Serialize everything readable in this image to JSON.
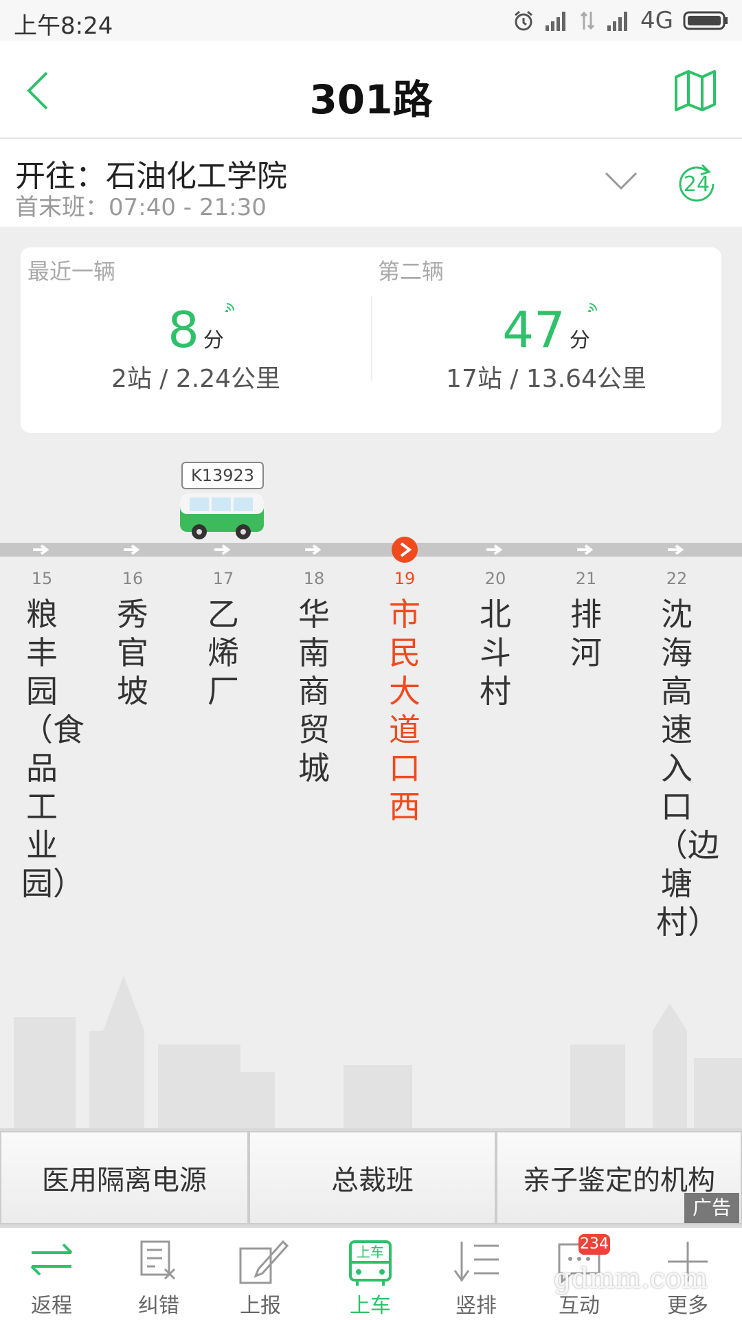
{
  "status_bar": {
    "time": "上午8:24",
    "network": "4G"
  },
  "header": {
    "title": "301路"
  },
  "direction": {
    "destination": "开往：石油化工学院",
    "schedule": "首末班：07:40 - 21:30",
    "refresh_seconds": "24"
  },
  "arrival": {
    "nearest": {
      "label": "最近一辆",
      "minutes": "8",
      "unit": "分",
      "detail": "2站 / 2.24公里"
    },
    "second": {
      "label": "第二辆",
      "minutes": "47",
      "unit": "分",
      "detail": "17站 / 13.64公里"
    }
  },
  "bus": {
    "plate": "K13923"
  },
  "stops": [
    {
      "num": "15",
      "name": "粮丰园（食品工业园）"
    },
    {
      "num": "16",
      "name": "秀官坡"
    },
    {
      "num": "17",
      "name": "乙烯厂"
    },
    {
      "num": "18",
      "name": "华南商贸城"
    },
    {
      "num": "19",
      "name": "市民大道口西",
      "current": true
    },
    {
      "num": "20",
      "name": "北斗村"
    },
    {
      "num": "21",
      "name": "排河"
    },
    {
      "num": "22",
      "name": "沈海高速入口（边塘村）"
    }
  ],
  "ads": {
    "items": [
      "医用隔离电源",
      "总裁班",
      "亲子鉴定的机构"
    ],
    "tag": "广告"
  },
  "bottom_nav": {
    "items": [
      "返程",
      "纠错",
      "上报",
      "上车",
      "竖排",
      "互动",
      "更多"
    ],
    "badge": "234",
    "onboard_icon_text": "上车"
  },
  "watermark": "gdmm.com",
  "colors": {
    "accent": "#2fc16a",
    "current_stop": "#f04a1e"
  }
}
